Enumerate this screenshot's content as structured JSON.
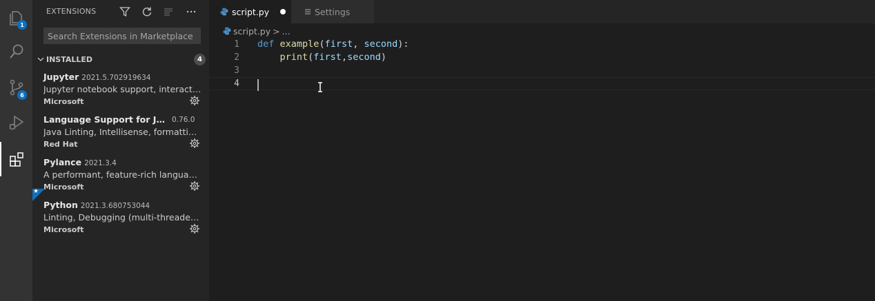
{
  "activity_bar": {
    "items": [
      {
        "icon": "files-icon",
        "badge": "1"
      },
      {
        "icon": "search-icon",
        "badge": ""
      },
      {
        "icon": "source-control-icon",
        "badge": "6"
      },
      {
        "icon": "run-debug-icon",
        "badge": ""
      },
      {
        "icon": "extensions-icon",
        "badge": ""
      }
    ]
  },
  "sidebar": {
    "title": "EXTENSIONS",
    "actions": [
      "filter-icon",
      "refresh-icon",
      "clear-icon",
      "more-icon"
    ],
    "search_placeholder": "Search Extensions in Marketplace",
    "section": {
      "title": "INSTALLED",
      "count": "4"
    },
    "extensions": [
      {
        "name": "Jupyter",
        "version": "2021.5.702919634",
        "description": "Jupyter notebook support, interactive programming and computing that supports Intellisense, debugging and more.",
        "publisher": "Microsoft"
      },
      {
        "name": "Language Support for Java(TM) by Red Hat",
        "version": "0.76.0",
        "description": "Java Linting, Intellisense, formatting, refactoring, Maven/Gradle support and more...",
        "publisher": "Red Hat"
      },
      {
        "name": "Pylance",
        "version": "2021.3.4",
        "description": "A performant, feature-rich language server for Python in VS Code",
        "publisher": "Microsoft"
      },
      {
        "name": "Python",
        "version": "2021.3.680753044",
        "description": "Linting, Debugging (multi-threaded, remote), Intellisense, Jupyter Notebooks, code formatting, refactoring, unit tests, and more.",
        "publisher": "Microsoft",
        "recommended": true
      }
    ]
  },
  "editor": {
    "tabs": [
      {
        "label": "script.py",
        "dirty": true,
        "active": true
      },
      {
        "label": "Settings",
        "dirty": false,
        "active": false
      }
    ],
    "breadcrumb": {
      "file": "script.py",
      "separator": ">",
      "rest": "..."
    },
    "lines": [
      {
        "number": "1",
        "tokens": {
          "kw": "def",
          "fn": "example",
          "p1": "(",
          "a1": "first",
          "p2": ", ",
          "a2": "second",
          "p3": "):"
        }
      },
      {
        "number": "2",
        "tokens": {
          "indent": "    ",
          "fn": "print",
          "p1": "(",
          "a1": "first",
          "p2": ",",
          "a2": "second",
          "p3": ")"
        }
      },
      {
        "number": "3"
      },
      {
        "number": "4"
      }
    ]
  },
  "colors": {
    "accent": "#0e70c0",
    "keyword": "#569cd6",
    "function": "#dcdcaa",
    "parameter": "#9cdcfe"
  }
}
